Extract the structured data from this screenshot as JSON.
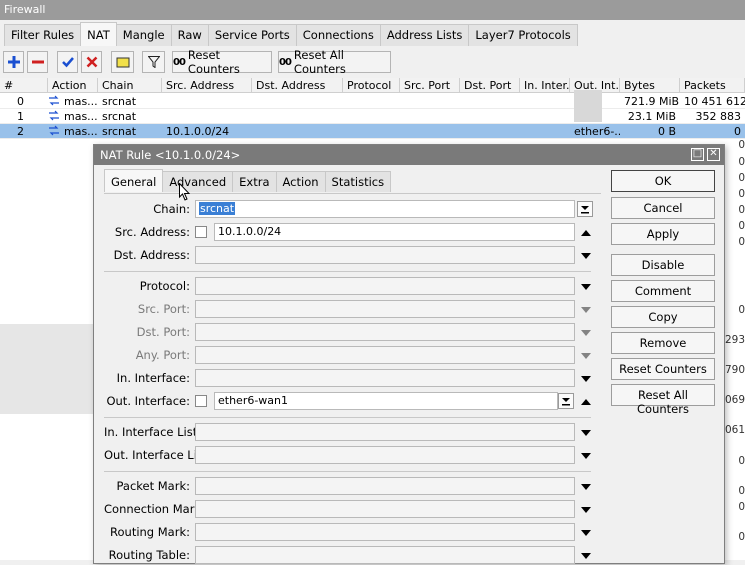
{
  "window": {
    "title": "Firewall"
  },
  "tabs": [
    "Filter Rules",
    "NAT",
    "Mangle",
    "Raw",
    "Service Ports",
    "Connections",
    "Address Lists",
    "Layer7 Protocols"
  ],
  "active_tab": "NAT",
  "toolbar": {
    "reset_counters": "Reset Counters",
    "reset_all_counters": "Reset All Counters",
    "counter_glyph": "00"
  },
  "table": {
    "columns": [
      "#",
      "Action",
      "Chain",
      "Src. Address",
      "Dst. Address",
      "Protocol",
      "Src. Port",
      "Dst. Port",
      "In. Inter...",
      "Out. Int...",
      "Bytes",
      "Packets"
    ],
    "rows": [
      {
        "num": "0",
        "action": "mas...",
        "chain": "srcnat",
        "src": "",
        "out": "",
        "bytes": "721.9 MiB",
        "packets": "10 451 612"
      },
      {
        "num": "1",
        "action": "mas...",
        "chain": "srcnat",
        "src": "",
        "out": "",
        "bytes": "23.1 MiB",
        "packets": "352 883"
      },
      {
        "num": "2",
        "action": "mas...",
        "chain": "srcnat",
        "src": "10.1.0.0/24",
        "out": "ether6-...",
        "bytes": "0 B",
        "packets": "0"
      }
    ],
    "right_edge_values": [
      "0",
      "0",
      "0",
      "0",
      "0",
      "0",
      "0",
      "0",
      "293",
      "790",
      "069",
      "061",
      "0",
      "0",
      "0",
      "0"
    ]
  },
  "dialog": {
    "title": "NAT Rule <10.1.0.0/24>",
    "tabs": [
      "General",
      "Advanced",
      "Extra",
      "Action",
      "Statistics"
    ],
    "active_tab": "General",
    "fields": {
      "chain": {
        "label": "Chain:",
        "value": "srcnat"
      },
      "src_address": {
        "label": "Src. Address:",
        "value": "10.1.0.0/24"
      },
      "dst_address": {
        "label": "Dst. Address:",
        "value": ""
      },
      "protocol": {
        "label": "Protocol:",
        "value": ""
      },
      "src_port": {
        "label": "Src. Port:",
        "value": ""
      },
      "dst_port": {
        "label": "Dst. Port:",
        "value": ""
      },
      "any_port": {
        "label": "Any. Port:",
        "value": ""
      },
      "in_interface": {
        "label": "In. Interface:",
        "value": ""
      },
      "out_interface": {
        "label": "Out. Interface:",
        "value": "ether6-wan1"
      },
      "in_interface_list": {
        "label": "In. Interface List:",
        "value": ""
      },
      "out_interface_list": {
        "label": "Out. Interface List:",
        "value": ""
      },
      "packet_mark": {
        "label": "Packet Mark:",
        "value": ""
      },
      "connection_mark": {
        "label": "Connection Mark:",
        "value": ""
      },
      "routing_mark": {
        "label": "Routing Mark:",
        "value": ""
      },
      "routing_table": {
        "label": "Routing Table:",
        "value": ""
      }
    },
    "buttons": [
      "OK",
      "Cancel",
      "Apply",
      "Disable",
      "Comment",
      "Copy",
      "Remove",
      "Reset Counters",
      "Reset All Counters"
    ]
  },
  "colors": {
    "selected_row": "#99c1ea",
    "dialog_title": "#7a7a7a",
    "add_icon": "#1a4fd1",
    "remove_icon": "#d02020"
  }
}
